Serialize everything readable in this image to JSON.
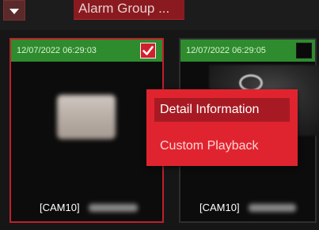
{
  "toolbar": {
    "alarm_group_label": "Alarm Group ..."
  },
  "tiles": [
    {
      "timestamp": "12/07/2022 06:29:03",
      "checked": true,
      "camera_label": "[CAM10]"
    },
    {
      "timestamp": "12/07/2022 06:29:05",
      "checked": false,
      "camera_label": "[CAM10]"
    }
  ],
  "context_menu": {
    "items": [
      {
        "label": "Detail Information",
        "highlighted": true
      },
      {
        "label": "Custom Playback",
        "highlighted": false
      }
    ]
  },
  "colors": {
    "accent_red": "#e0242f",
    "header_green": "#2e8b2e",
    "background": "#121212"
  },
  "icons": {
    "dropdown": "dropdown-triangle-icon",
    "check": "checkmark-icon"
  }
}
